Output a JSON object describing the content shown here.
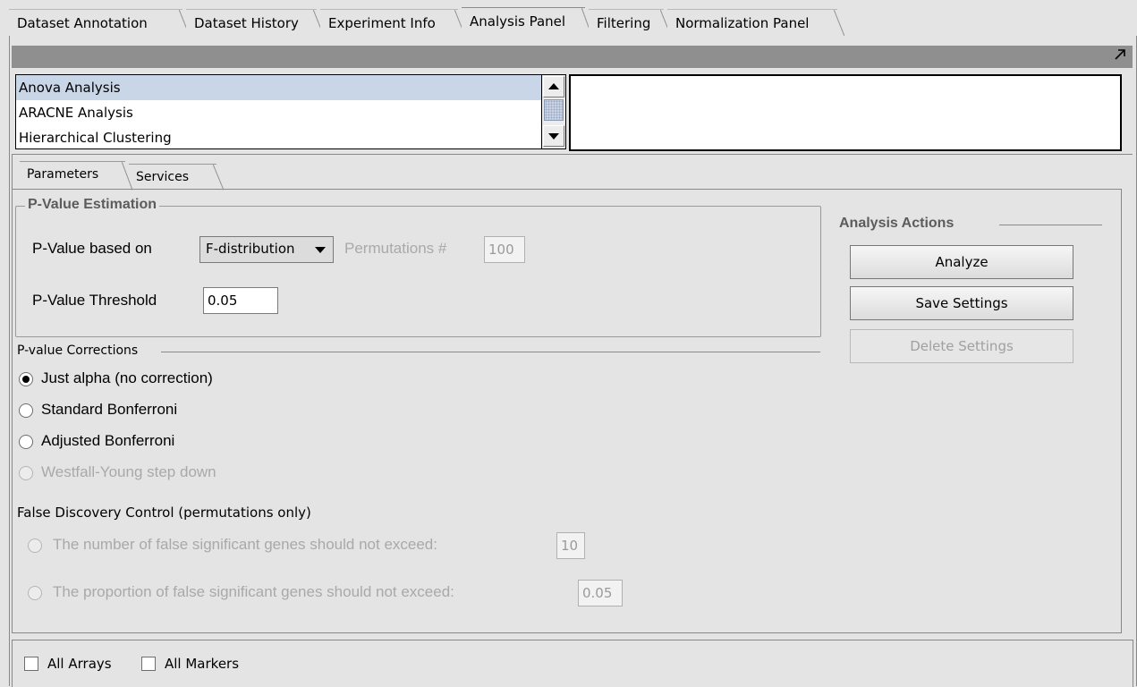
{
  "top_tabs": [
    {
      "label": "Dataset Annotation"
    },
    {
      "label": "Dataset History"
    },
    {
      "label": "Experiment Info"
    },
    {
      "label": "Analysis Panel"
    },
    {
      "label": "Filtering"
    },
    {
      "label": "Normalization Panel"
    }
  ],
  "active_top_tab": "Analysis Panel",
  "toolbar": {
    "expand_icon": "expand-arrow-icon"
  },
  "analysis_list": {
    "items": [
      "Anova Analysis",
      "ARACNE Analysis",
      "Hierarchical Clustering"
    ],
    "selected": "Anova Analysis"
  },
  "sub_tabs": [
    {
      "label": "Parameters"
    },
    {
      "label": "Services"
    }
  ],
  "pvalue_estimation": {
    "title": "P-Value Estimation",
    "based_on_label": "P-Value based on",
    "based_on_value": "F-distribution",
    "permutations_label": "Permutations #",
    "permutations_value": "100",
    "threshold_label": "P-Value Threshold",
    "threshold_value": "0.05"
  },
  "corrections": {
    "title": "P-value Corrections",
    "options": [
      {
        "label": "Just alpha (no correction)",
        "checked": true,
        "enabled": true
      },
      {
        "label": "Standard Bonferroni",
        "checked": false,
        "enabled": true
      },
      {
        "label": "Adjusted Bonferroni",
        "checked": false,
        "enabled": true
      },
      {
        "label": "Westfall-Young step down",
        "checked": false,
        "enabled": false
      }
    ]
  },
  "fdc": {
    "title": "False Discovery Control (permutations only)",
    "number_label": "The number of false significant genes should not exceed:",
    "number_value": "10",
    "proportion_label": "The proportion of false significant genes should not exceed:",
    "proportion_value": "0.05"
  },
  "actions": {
    "title": "Analysis Actions",
    "analyze": "Analyze",
    "save": "Save Settings",
    "delete": "Delete Settings"
  },
  "bottom": {
    "all_arrays": "All Arrays",
    "all_markers": "All Markers"
  }
}
